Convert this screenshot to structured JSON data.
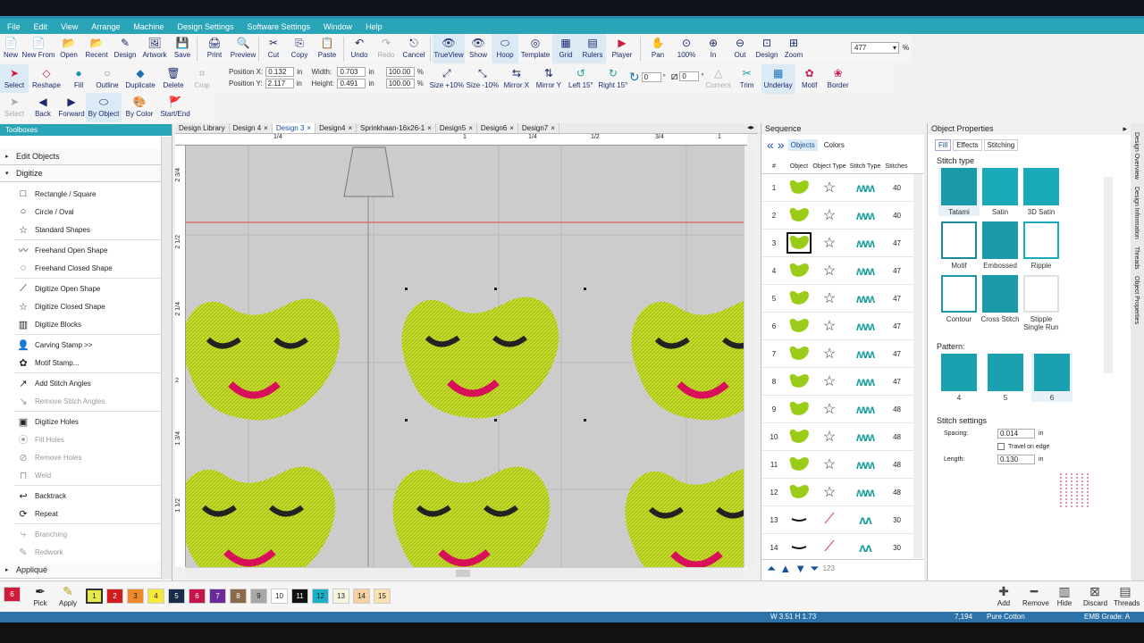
{
  "menu": [
    "File",
    "Edit",
    "View",
    "Arrange",
    "Machine",
    "Design Settings",
    "Software Settings",
    "Window",
    "Help"
  ],
  "toolbar1": [
    "New",
    "New From",
    "Open",
    "Recent",
    "Design",
    "Artwork",
    "Save",
    "Print",
    "Preview",
    "Cut",
    "Copy",
    "Paste",
    "Undo",
    "Redo",
    "Cancel",
    "TrueView",
    "Show",
    "Hoop",
    "Template",
    "Grid",
    "Rulers",
    "Player",
    "Pan",
    "100%",
    "In",
    "Out",
    "Design",
    "Zoom"
  ],
  "zoom_value": "477",
  "zoom_unit": "%",
  "toolbar2": {
    "select": "Select",
    "reshape": "Reshape",
    "fill": "Fill",
    "outline": "Outline",
    "duplicate": "Duplicate",
    "delete": "Delete",
    "crop": "Crop",
    "pos_x_label": "Position X:",
    "pos_x": "0.132",
    "pos_y_label": "Position Y:",
    "pos_y": "2.117",
    "unit": "in",
    "width_label": "Width:",
    "width": "0.703",
    "height_label": "Height:",
    "height": "0.491",
    "pct1": "100.00",
    "pct2": "100.00",
    "pct": "%",
    "size_up": "Size +10%",
    "size_down": "Size -10%",
    "mirror_x": "Mirror X",
    "mirror_y": "Mirror Y",
    "left15": "Left 15°",
    "right15": "Right 15°",
    "rotate_value": "0",
    "deg": "°",
    "angle_value": "0",
    "corners": "Corners",
    "trim": "Trim",
    "underlay": "Underlay",
    "motif": "Motif",
    "border": "Border"
  },
  "toolbar3": [
    "Select",
    "Back",
    "Forward",
    "By Object",
    "By Color",
    "Start/End"
  ],
  "toolbox": {
    "title": "Toolboxes",
    "group_edit": "Edit Objects",
    "group_digitize": "Digitize",
    "items": [
      {
        "label": "Rectangle / Square",
        "icon": "rectangle-icon",
        "dis": false
      },
      {
        "label": "Circle / Oval",
        "icon": "circle-icon",
        "dis": false
      },
      {
        "label": "Standard Shapes",
        "icon": "shapes-icon",
        "dis": false
      },
      {
        "label": "Freehand Open Shape",
        "icon": "freehand-open-icon",
        "dis": false
      },
      {
        "label": "Freehand Closed Shape",
        "icon": "freehand-closed-icon",
        "dis": false
      },
      {
        "label": "Digitize Open Shape",
        "icon": "digitize-open-icon",
        "dis": false
      },
      {
        "label": "Digitize Closed Shape",
        "icon": "digitize-closed-icon",
        "dis": false
      },
      {
        "label": "Digitize Blocks",
        "icon": "digitize-blocks-icon",
        "dis": false
      },
      {
        "label": "Carving Stamp >>",
        "icon": "carving-stamp-icon",
        "dis": false
      },
      {
        "label": "Motif Stamp...",
        "icon": "motif-stamp-icon",
        "dis": false
      },
      {
        "label": "Add Stitch Angles",
        "icon": "add-angles-icon",
        "dis": false
      },
      {
        "label": "Remove Stitch Angles",
        "icon": "remove-angles-icon",
        "dis": true
      },
      {
        "label": "Digitize Holes",
        "icon": "digitize-holes-icon",
        "dis": false
      },
      {
        "label": "Fill Holes",
        "icon": "fill-holes-icon",
        "dis": true
      },
      {
        "label": "Remove Holes",
        "icon": "remove-holes-icon",
        "dis": true
      },
      {
        "label": "Weld",
        "icon": "weld-icon",
        "dis": true
      },
      {
        "label": "Backtrack",
        "icon": "backtrack-icon",
        "dis": false
      },
      {
        "label": "Repeat",
        "icon": "repeat-icon",
        "dis": false
      },
      {
        "label": "Branching",
        "icon": "branching-icon",
        "dis": true
      },
      {
        "label": "Redwork",
        "icon": "redwork-icon",
        "dis": true
      }
    ],
    "group_applique": "Appliqué"
  },
  "doc_tabs": [
    "Design Library",
    "Design 4",
    "Design 3",
    "Design4",
    "Sprinkhaan-16x26-1",
    "Design5",
    "Design6",
    "Design7"
  ],
  "active_tab": "Design 3",
  "ruler_h": [
    "1/4",
    "1",
    "1/4",
    "1/2",
    "3/4",
    "1"
  ],
  "ruler_v": [
    "2 3/4",
    "2 1/2",
    "2 1/4",
    "2",
    "1 3/4",
    "1 1/2"
  ],
  "sequence": {
    "title": "Sequence",
    "tab_objects": "Objects",
    "tab_colors": "Colors",
    "col_num": "#",
    "col_object": "Object",
    "col_type": "Object Type",
    "col_stitch": "Stitch Type",
    "col_stitches": "Stitches",
    "rows": [
      {
        "n": "1",
        "count": "40"
      },
      {
        "n": "2",
        "count": "40"
      },
      {
        "n": "3",
        "count": "47"
      },
      {
        "n": "4",
        "count": "47"
      },
      {
        "n": "5",
        "count": "47"
      },
      {
        "n": "6",
        "count": "47"
      },
      {
        "n": "7",
        "count": "47"
      },
      {
        "n": "8",
        "count": "47"
      },
      {
        "n": "9",
        "count": "48"
      },
      {
        "n": "10",
        "count": "48"
      },
      {
        "n": "11",
        "count": "48"
      },
      {
        "n": "12",
        "count": "48"
      },
      {
        "n": "13",
        "count": "30"
      },
      {
        "n": "14",
        "count": "30"
      }
    ],
    "footer_num": "123"
  },
  "properties": {
    "title": "Object Properties",
    "tabs": [
      "Fill",
      "Effects",
      "Stitching"
    ],
    "stitch_type_label": "Stitch type",
    "stitch_types": [
      "Tatami",
      "Satin",
      "3D Satin",
      "Motif",
      "Embossed",
      "Ripple",
      "Contour",
      "Cross Stitch",
      "Stipple Single Run"
    ],
    "pattern_label": "Pattern:",
    "patterns": [
      "4",
      "5",
      "6"
    ],
    "stitch_settings_label": "Stitch settings",
    "spacing_label": "Spacing:",
    "spacing": "0.014",
    "unit": "in",
    "travel_label": "Travel on edge",
    "length_label": "Length:",
    "length": "0.130"
  },
  "right_strip": [
    "Design Overview",
    "Design Information",
    "Threads",
    "Object Properties"
  ],
  "palette": [
    "1",
    "2",
    "3",
    "4",
    "5",
    "6",
    "7",
    "8",
    "9",
    "10",
    "11",
    "12",
    "13",
    "14",
    "15"
  ],
  "palette_colors": [
    "#e8e84a",
    "#d01c1c",
    "#f08a28",
    "#f5e83c",
    "#1a2a4a",
    "#c8134a",
    "#6a2a9a",
    "#8a6a4a",
    "#a8a8a8",
    "#ffffff",
    "#111111",
    "#1ab0c8",
    "#f5f5e0",
    "#f5d0a0",
    "#f8e0b0"
  ],
  "pick": "Pick",
  "apply": "Apply",
  "bottom_right": [
    "Add",
    "Remove",
    "Hide",
    "Discard",
    "Threads"
  ],
  "status": {
    "size": "W 3.51 H 1.73",
    "stitches": "7,194",
    "thread": "Pure Cotton",
    "grade": "EMB Grade: A"
  }
}
